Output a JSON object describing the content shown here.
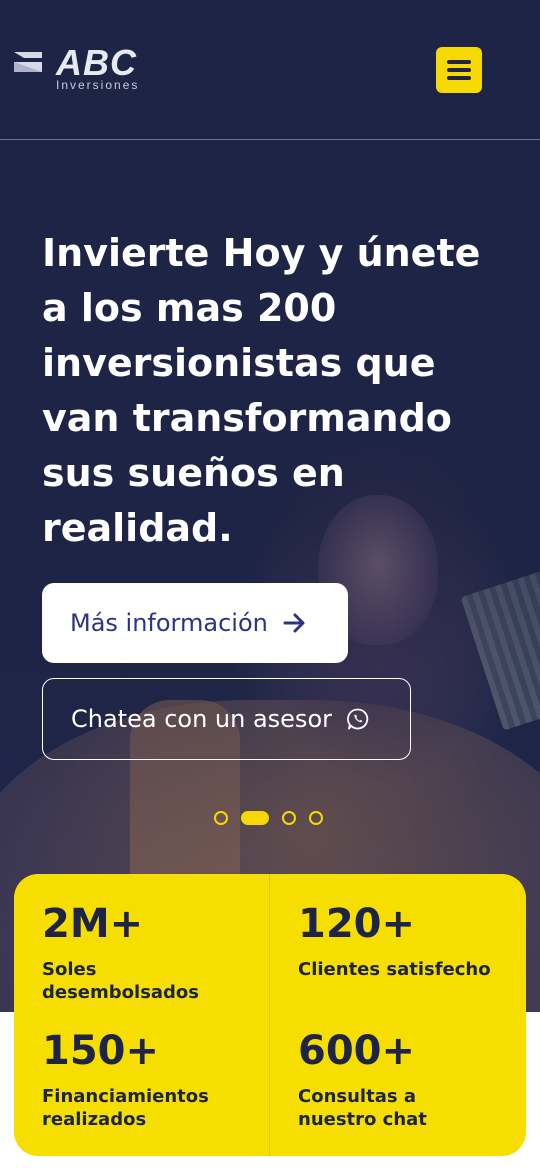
{
  "brand": {
    "name": "ABC",
    "tagline": "Inversiones"
  },
  "header": {
    "menu_icon": "hamburger-menu-icon"
  },
  "hero": {
    "headline_part1": "Invierte Hoy y únete a los mas ",
    "headline_highlight": "200",
    "headline_part2": " inversionistas que van transformando sus sueños en realidad.",
    "info_button_label": "Más información",
    "info_button_icon": "arrow-right-icon",
    "chat_button_label": "Chatea con un asesor",
    "chat_button_icon": "whatsapp-icon",
    "slides": 4,
    "active_slide": 2
  },
  "stats": [
    {
      "value": "2M+",
      "label": "Soles desembolsados"
    },
    {
      "value": "120+",
      "label": "Clientes satisfecho"
    },
    {
      "value": "150+",
      "label": "Financiamientos realizados"
    },
    {
      "value": "600+",
      "label": "Consultas a nuestro chat"
    }
  ],
  "colors": {
    "navy": "#1d2445",
    "accent_yellow": "#f6df00",
    "button_text_blue": "#2b3486"
  }
}
